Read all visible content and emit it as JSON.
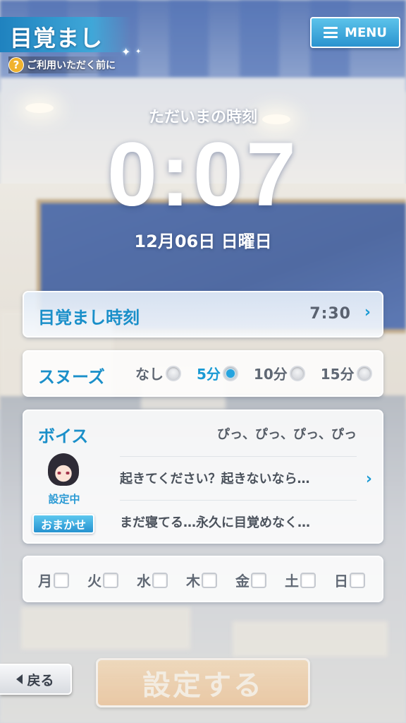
{
  "header": {
    "title": "目覚まし",
    "help_text": "ご利用いただく前に",
    "help_icon": "?",
    "menu_label": "MENU"
  },
  "clock": {
    "caption": "ただいまの時刻",
    "time": "0:07",
    "date": "12月06日 日曜日"
  },
  "alarm": {
    "label": "目覚まし時刻",
    "value": "7:30",
    "chevron": "›"
  },
  "snooze": {
    "label": "スヌーズ",
    "options": [
      {
        "label": "なし",
        "selected": false
      },
      {
        "label": "5分",
        "selected": true
      },
      {
        "label": "10分",
        "selected": false
      },
      {
        "label": "15分",
        "selected": false
      }
    ]
  },
  "voice": {
    "label": "ボイス",
    "lines": [
      "ぴっ、ぴっ、ぴっ、ぴっ",
      "起きてください？起きないなら…",
      "まだ寝てる…永久に目覚めなく…"
    ],
    "chevron": "›",
    "status": "設定中",
    "omakase_label": "おまかせ"
  },
  "days": [
    {
      "label": "月",
      "checked": false
    },
    {
      "label": "火",
      "checked": false
    },
    {
      "label": "水",
      "checked": false
    },
    {
      "label": "木",
      "checked": false
    },
    {
      "label": "金",
      "checked": false
    },
    {
      "label": "土",
      "checked": false
    },
    {
      "label": "日",
      "checked": false
    }
  ],
  "footer": {
    "back_label": "戻る",
    "submit_label": "設定する",
    "submit_enabled": false
  },
  "colors": {
    "accent": "#1a8fc9",
    "menu_button": "#2a93cf",
    "submit_button": "#f6b26c"
  }
}
